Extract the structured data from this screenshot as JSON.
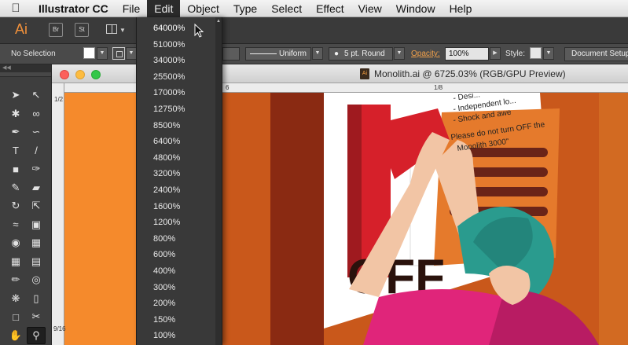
{
  "menubar": {
    "app_name": "Illustrator CC",
    "items": [
      "File",
      "Edit",
      "Object",
      "Type",
      "Select",
      "Effect",
      "View",
      "Window",
      "Help"
    ],
    "active_item": "Edit"
  },
  "appbar": {
    "logo": "Ai",
    "bridge_label": "Br",
    "stock_label": "St",
    "arrange_icon": "arrange-documents-icon"
  },
  "controlbar": {
    "selection": "No Selection",
    "stroke_profile": "Uniform",
    "brush": "5 pt. Round",
    "opacity_label": "Opacity:",
    "opacity_value": "100%",
    "style_label": "Style:",
    "document_setup": "Document Setup"
  },
  "document": {
    "title": "Monolith.ai @ 6725.03% (RGB/GPU Preview)",
    "file_icon_label": "Ai",
    "ruler_h_labels": [
      "6",
      "1/8"
    ],
    "ruler_v_top": "1/2",
    "ruler_v_bottom": "9/16"
  },
  "artwork": {
    "sign_lines": [
      "- Desi...",
      "- Independent lo...",
      "- Shock and awe",
      "Please do not turn OFF the",
      "Monolith 3000\""
    ],
    "switch_text": "OFF"
  },
  "zoom_menu": {
    "options": [
      "64000%",
      "51000%",
      "34000%",
      "25500%",
      "17000%",
      "12750%",
      "8500%",
      "6400%",
      "4800%",
      "3200%",
      "2400%",
      "1600%",
      "1200%",
      "800%",
      "600%",
      "400%",
      "300%",
      "200%",
      "150%",
      "100%"
    ],
    "hovered": "64000%"
  },
  "tools": [
    "selection-tool",
    "direct-selection-tool",
    "magic-wand-tool",
    "lasso-tool",
    "pen-tool",
    "curvature-tool",
    "type-tool",
    "line-tool",
    "rectangle-tool",
    "paintbrush-tool",
    "pencil-tool",
    "eraser-tool",
    "rotate-tool",
    "scale-tool",
    "width-tool",
    "free-transform-tool",
    "shape-builder-tool",
    "perspective-grid-tool",
    "mesh-tool",
    "gradient-tool",
    "eyedropper-tool",
    "blend-tool",
    "symbol-sprayer-tool",
    "column-graph-tool",
    "artboard-tool",
    "slice-tool",
    "hand-tool",
    "zoom-tool"
  ],
  "colors": {
    "canvas_orange": "#f58a2c",
    "dark_orange": "#c9581b",
    "hair_teal": "#2a9b8e",
    "shirt_pink": "#e0257a",
    "switch_red": "#d6202a"
  }
}
